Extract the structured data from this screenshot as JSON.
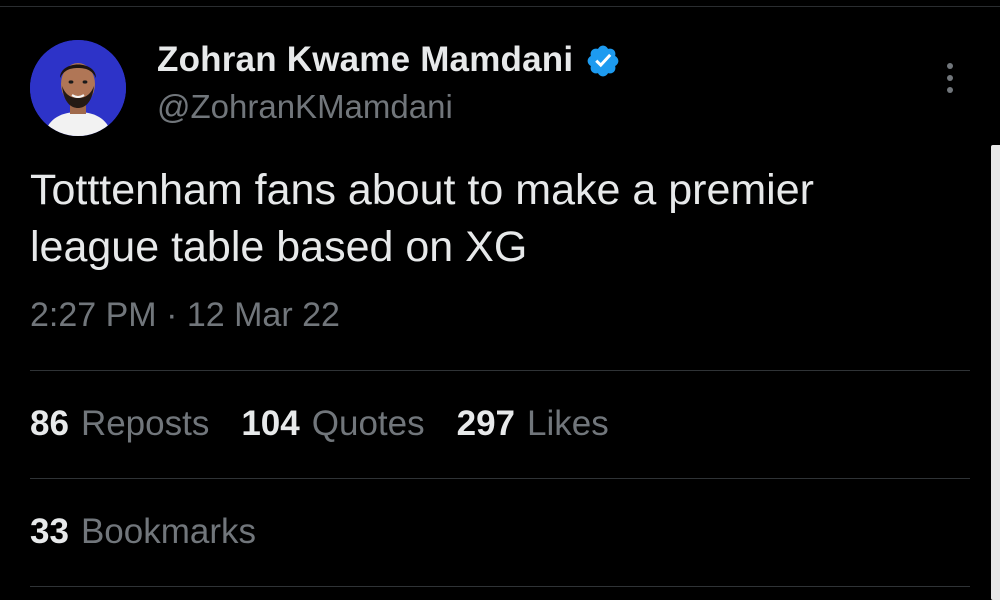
{
  "tweet": {
    "author": {
      "display_name": "Zohran Kwame Mamdani",
      "handle": "@ZohranKMamdani",
      "verified": true,
      "avatar_bg": "#2d33c8"
    },
    "text": "Totttenham fans about to make a premier\nleague table based on XG",
    "time": "2:27 PM",
    "separator": " · ",
    "date": "12 Mar 22"
  },
  "stats": {
    "reposts": {
      "count": "86",
      "label": "Reposts"
    },
    "quotes": {
      "count": "104",
      "label": "Quotes"
    },
    "likes": {
      "count": "297",
      "label": "Likes"
    },
    "bookmarks": {
      "count": "33",
      "label": "Bookmarks"
    }
  },
  "icons": {
    "verified": "verified-badge-icon",
    "more": "more-vertical-icon"
  },
  "colors": {
    "background": "#000000",
    "primary_text": "#e7e9ea",
    "secondary_text": "#71767b",
    "divider": "#2f3336",
    "verified_blue": "#1d9bf0"
  }
}
